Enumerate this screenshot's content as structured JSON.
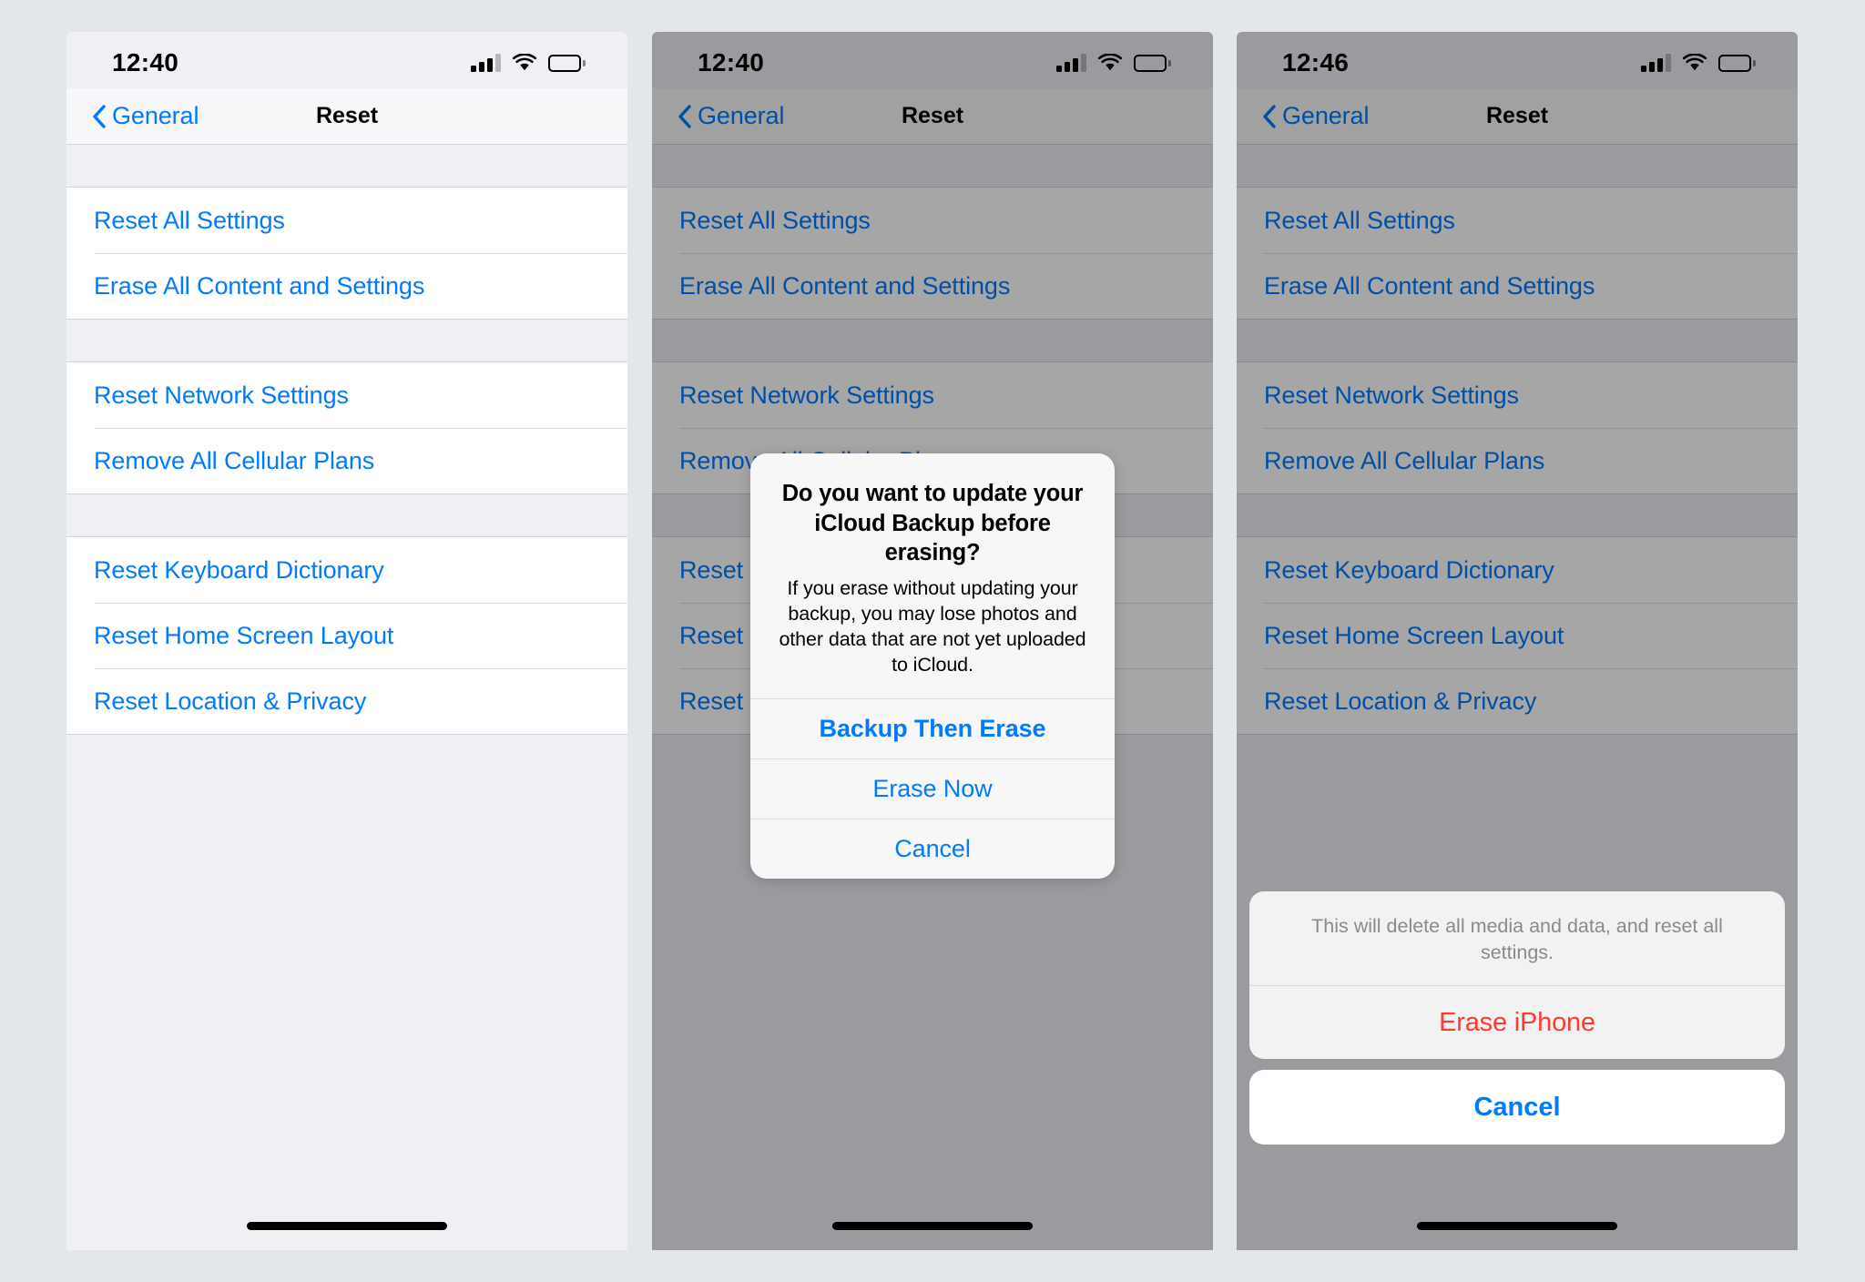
{
  "background_color": "#e3e7ea",
  "accent_color": "#007aff",
  "destructive_color": "#ff3b30",
  "panels": [
    {
      "id": "panel-normal",
      "status": {
        "time": "12:40",
        "signal_icon": "cellular-signal-icon",
        "wifi_icon": "wifi-icon",
        "battery_icon": "battery-icon"
      },
      "nav": {
        "back_label": "General",
        "title": "Reset",
        "back_icon": "chevron-left-icon"
      },
      "groups": [
        {
          "rows": [
            "Reset All Settings",
            "Erase All Content and Settings"
          ]
        },
        {
          "rows": [
            "Reset Network Settings",
            "Remove All Cellular Plans"
          ]
        },
        {
          "rows": [
            "Reset Keyboard Dictionary",
            "Reset Home Screen Layout",
            "Reset Location & Privacy"
          ]
        }
      ],
      "dimmed": false
    },
    {
      "id": "panel-alert",
      "status": {
        "time": "12:40",
        "signal_icon": "cellular-signal-icon",
        "wifi_icon": "wifi-icon",
        "battery_icon": "battery-icon"
      },
      "nav": {
        "back_label": "General",
        "title": "Reset",
        "back_icon": "chevron-left-icon"
      },
      "groups": [
        {
          "rows": [
            "Reset All Settings",
            "Erase All Content and Settings"
          ]
        },
        {
          "rows": [
            "Reset Network Settings",
            "Remove All Cellular Plans"
          ]
        },
        {
          "rows": [
            "Reset Keyboard Dictionary",
            "Reset Home Screen Layout",
            "Reset Location & Privacy"
          ]
        }
      ],
      "dimmed": true
    },
    {
      "id": "panel-sheet",
      "status": {
        "time": "12:46",
        "signal_icon": "cellular-signal-icon",
        "wifi_icon": "wifi-icon",
        "battery_icon": "battery-icon"
      },
      "nav": {
        "back_label": "General",
        "title": "Reset",
        "back_icon": "chevron-left-icon"
      },
      "groups": [
        {
          "rows": [
            "Reset All Settings",
            "Erase All Content and Settings"
          ]
        },
        {
          "rows": [
            "Reset Network Settings",
            "Remove All Cellular Plans"
          ]
        },
        {
          "rows": [
            "Reset Keyboard Dictionary",
            "Reset Home Screen Layout",
            "Reset Location & Privacy"
          ]
        }
      ],
      "dimmed": true
    }
  ],
  "alert": {
    "title": "Do you want to update your iCloud Backup before erasing?",
    "message": "If you erase without updating your backup, you may lose photos and other data that are not yet uploaded to iCloud.",
    "buttons": [
      {
        "label": "Backup Then Erase",
        "style": "bold"
      },
      {
        "label": "Erase Now",
        "style": "default"
      },
      {
        "label": "Cancel",
        "style": "default"
      }
    ]
  },
  "action_sheet": {
    "title": "This will delete all media and data, and reset all settings.",
    "destructive_label": "Erase iPhone",
    "cancel_label": "Cancel"
  }
}
